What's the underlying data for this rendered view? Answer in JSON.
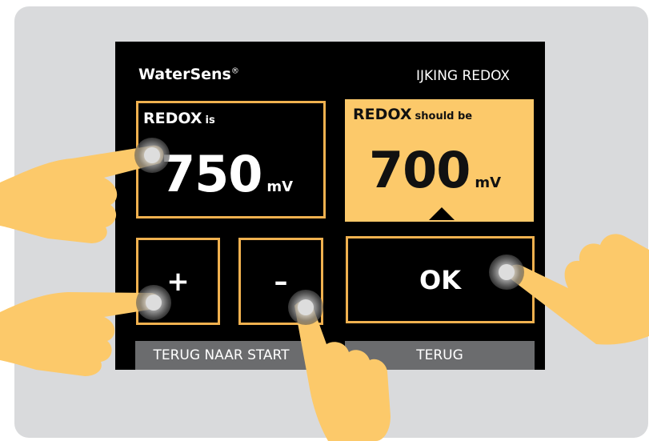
{
  "device": {
    "brand": "WaterSens",
    "brand_mark": "®",
    "screen_title": "IJKING REDOX"
  },
  "redox_is": {
    "label": "REDOX",
    "label_suffix": "is",
    "value": "750",
    "unit": "mV"
  },
  "redox_should": {
    "label": "REDOX",
    "label_suffix": "should be",
    "value": "700",
    "unit": "mV"
  },
  "buttons": {
    "plus": "+",
    "minus": "–",
    "ok": "OK",
    "back_to_start": "TERUG NAAR START",
    "back": "TERUG"
  },
  "colors": {
    "accent": "#f0b14f",
    "highlight_fill": "#fcc96a",
    "screen_bg": "#000000",
    "footer_button": "#6b6c6e"
  },
  "icons": [
    "touch-indicator-icon",
    "pointing-hand-icon"
  ]
}
